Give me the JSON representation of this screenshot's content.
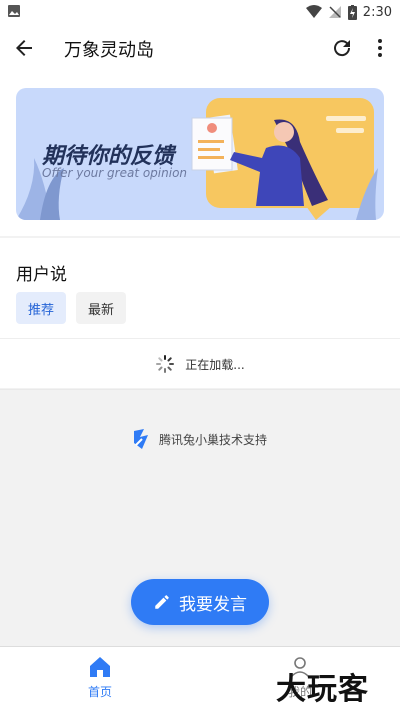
{
  "status_bar": {
    "time": "2:30"
  },
  "app_bar": {
    "title": "万象灵动岛"
  },
  "banner": {
    "headline": "期待你的反馈",
    "subtitle": "Offer your great opinion"
  },
  "section": {
    "heading": "用户说",
    "tabs": [
      {
        "label": "推荐",
        "active": true
      },
      {
        "label": "最新",
        "active": false
      }
    ],
    "loading_text": "正在加载..."
  },
  "support_text": "腾讯兔小巢技术支持",
  "fab": {
    "label": "我要发言"
  },
  "bottom_nav": {
    "home": "首页",
    "mine": "我的"
  },
  "watermark": "大玩客",
  "colors": {
    "accent": "#2f7bf5",
    "tab_active_bg": "#e4ecfc"
  }
}
